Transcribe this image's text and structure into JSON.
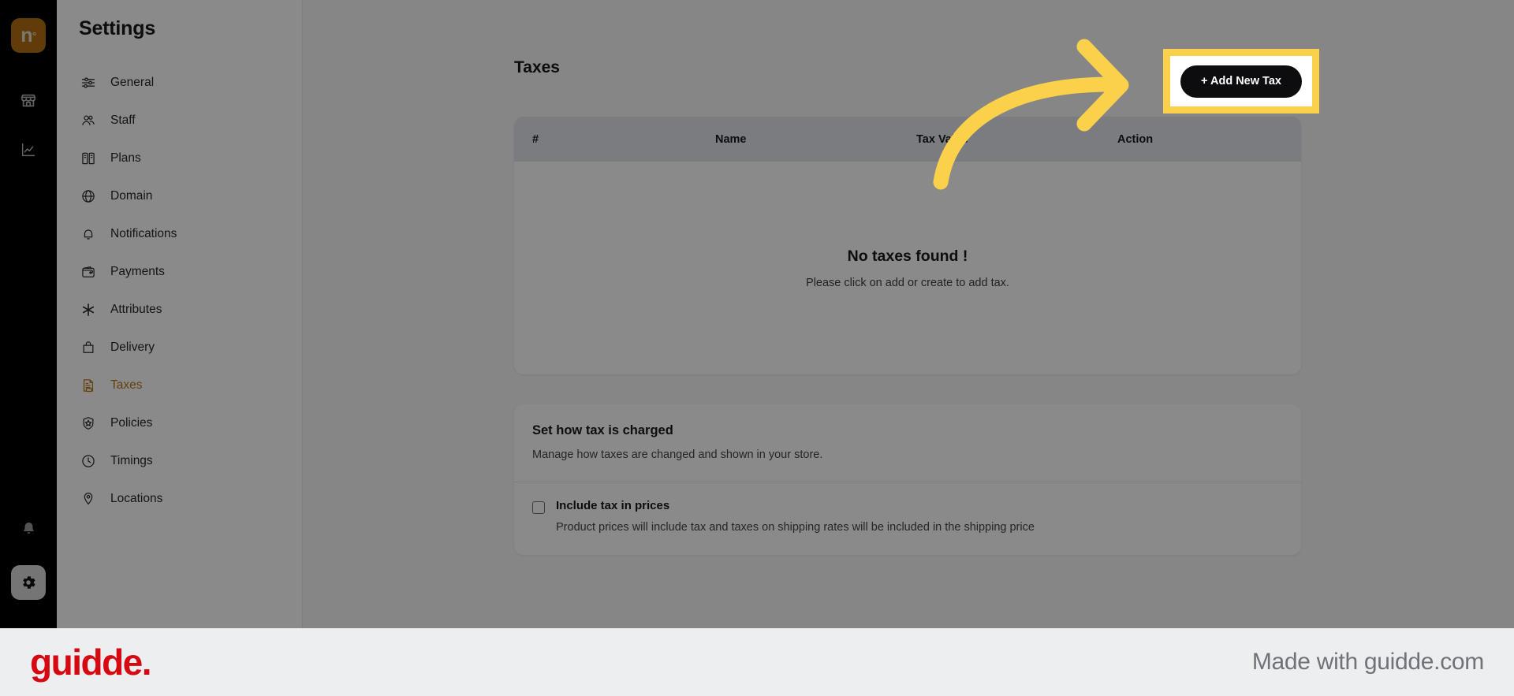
{
  "rail": {
    "logo_text": "n",
    "logo_sup": "°",
    "logo_name": "brand-logo",
    "items": [
      {
        "icon": "storefront-icon",
        "label": "Store"
      },
      {
        "icon": "analytics-chart-icon",
        "label": "Analytics"
      }
    ],
    "bell_icon": "bell-icon",
    "gear_icon": "gear-icon"
  },
  "sidebar": {
    "title": "Settings",
    "items": [
      {
        "label": "General",
        "icon": "sliders-icon",
        "active": false
      },
      {
        "label": "Staff",
        "icon": "people-icon",
        "active": false
      },
      {
        "label": "Plans",
        "icon": "plans-book-icon",
        "active": false
      },
      {
        "label": "Domain",
        "icon": "globe-icon",
        "active": false
      },
      {
        "label": "Notifications",
        "icon": "bell-icon",
        "active": false
      },
      {
        "label": "Payments",
        "icon": "wallet-icon",
        "active": false
      },
      {
        "label": "Attributes",
        "icon": "asterisk-icon",
        "active": false
      },
      {
        "label": "Delivery",
        "icon": "bag-icon",
        "active": false
      },
      {
        "label": "Taxes",
        "icon": "tax-document-icon",
        "active": true
      },
      {
        "label": "Policies",
        "icon": "shield-star-icon",
        "active": false
      },
      {
        "label": "Timings",
        "icon": "clock-icon",
        "active": false
      },
      {
        "label": "Locations",
        "icon": "location-pin-icon",
        "active": false
      }
    ],
    "active_color": "#b5761b"
  },
  "main": {
    "page_title": "Taxes",
    "add_button_label": "+ Add New Tax",
    "table": {
      "columns": [
        "#",
        "Name",
        "Tax Value",
        "Action"
      ],
      "rows": []
    },
    "empty_state": {
      "title": "No taxes found !",
      "subtitle": "Please click on add or create to add tax."
    },
    "charge_section": {
      "title": "Set how tax is charged",
      "subtitle": "Manage how taxes are changed and shown in your store.",
      "checkbox_label": "Include tax in prices",
      "checkbox_description": "Product prices will include tax and taxes on shipping rates will be included in the shipping price",
      "checkbox_checked": false
    }
  },
  "annotation": {
    "highlight_label": "+ Add New Tax",
    "highlight_color": "#FBD14B",
    "arrow_color": "#FBD14B",
    "arrow_name": "pointer-arrow"
  },
  "footer": {
    "logo_text": "guidde.",
    "logo_color": "#d60812",
    "made_with": "Made with guidde.com"
  }
}
